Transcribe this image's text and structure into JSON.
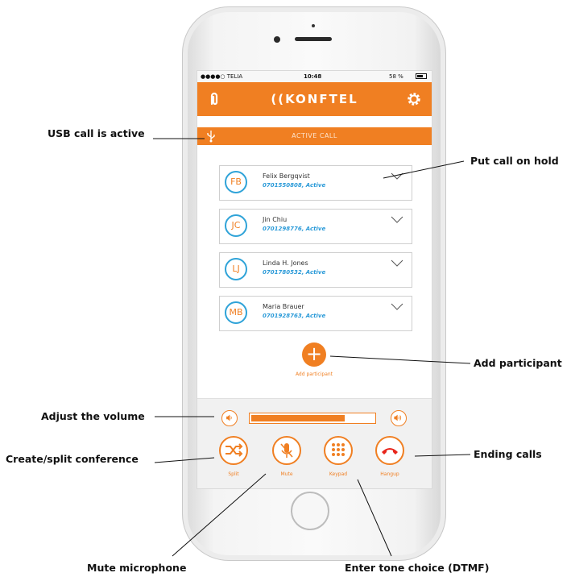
{
  "status": {
    "carrier": "●●●●○ TELIA",
    "time": "10:48",
    "battery": "58 %"
  },
  "app": {
    "logo": "((KONFTEL",
    "active_call_label": "ACTIVE CALL"
  },
  "participants": [
    {
      "initials": "FB",
      "name": "Felix Bergqvist",
      "info": "0701550808, Active"
    },
    {
      "initials": "JC",
      "name": "Jin Chiu",
      "info": "0701298776, Active"
    },
    {
      "initials": "LJ",
      "name": "Linda H. Jones",
      "info": "0701780532, Active"
    },
    {
      "initials": "MB",
      "name": "Maria Brauer",
      "info": "0701928763, Active"
    }
  ],
  "add": {
    "icon": "+",
    "label": "Add participant"
  },
  "volume": {
    "level_percent": 76
  },
  "controls": {
    "split": "Split",
    "mute": "Mute",
    "keypad": "Keypad",
    "hangup": "Hangup"
  },
  "callouts": {
    "usb": "USB call is active",
    "hold": "Put call on hold",
    "add": "Add participant",
    "volume": "Adjust the volume",
    "split": "Create/split conference",
    "ending": "Ending calls",
    "mute": "Mute microphone",
    "dtmf": "Enter tone choice (DTMF)"
  },
  "colors": {
    "accent": "#f07f22",
    "info": "#2a9ad8",
    "avatar_ring": "#2fa3d8"
  },
  "icons": [
    "clip-icon",
    "gear-icon",
    "usb-icon",
    "chevron-down-icon",
    "plus-icon",
    "volume-down-icon",
    "volume-up-icon",
    "split-icon",
    "mic-muted-icon",
    "keypad-icon",
    "hangup-icon"
  ]
}
